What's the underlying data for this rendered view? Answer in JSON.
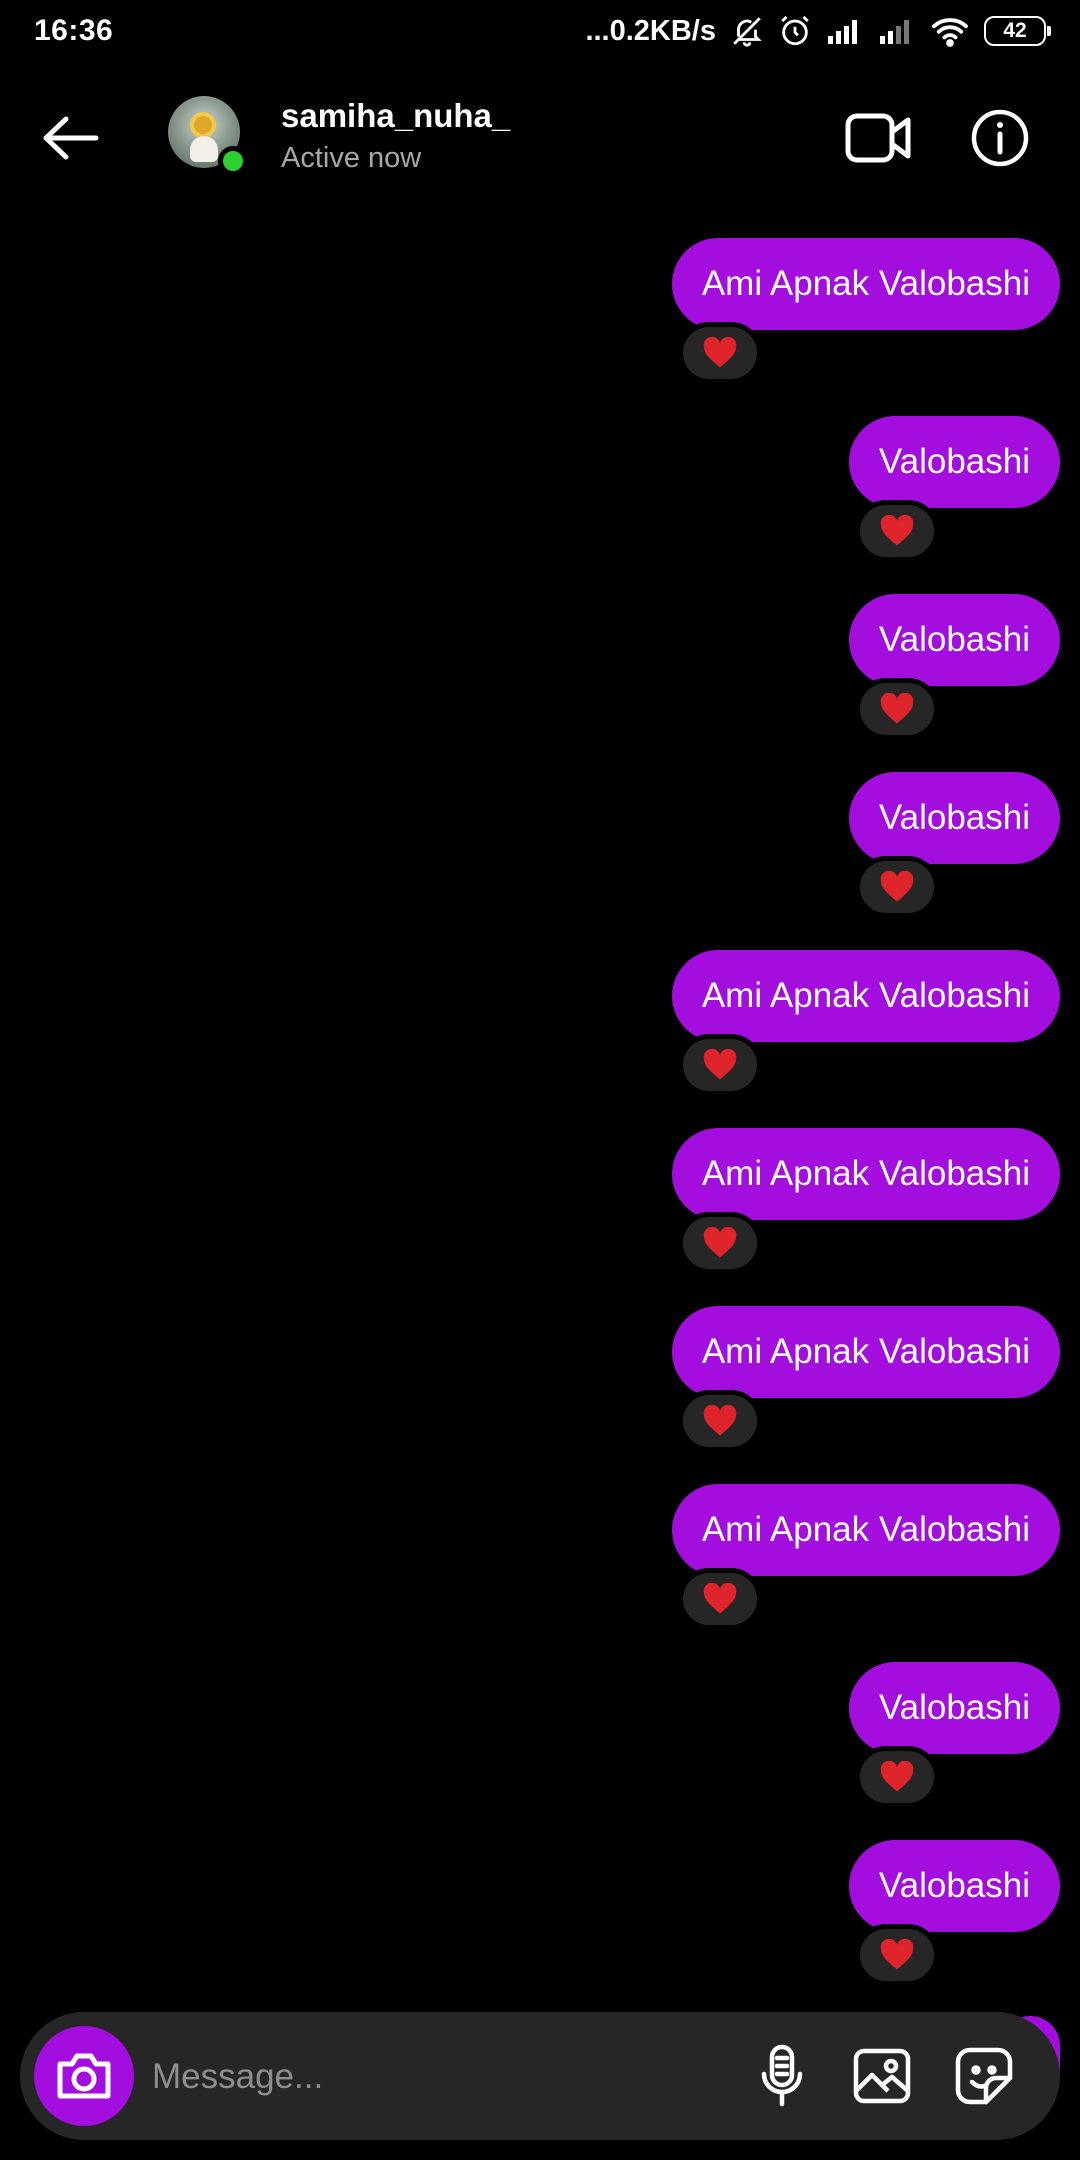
{
  "status_bar": {
    "time": "16:36",
    "network_speed": "...0.2KB/s",
    "battery": "42",
    "icons": [
      "mute-icon",
      "alarm-icon",
      "signal-icon",
      "signal-icon",
      "wifi-icon"
    ]
  },
  "header": {
    "username": "samiha_nuha_",
    "status": "Active now"
  },
  "messages": [
    {
      "text": "Ami Apnak Valobashi",
      "reaction": "❤️"
    },
    {
      "text": "Valobashi",
      "reaction": "❤️"
    },
    {
      "text": "Valobashi",
      "reaction": "❤️"
    },
    {
      "text": "Valobashi",
      "reaction": "❤️"
    },
    {
      "text": "Ami Apnak Valobashi",
      "reaction": "❤️"
    },
    {
      "text": "Ami Apnak Valobashi",
      "reaction": "❤️"
    },
    {
      "text": "Ami Apnak Valobashi",
      "reaction": "❤️"
    },
    {
      "text": "Ami Apnak Valobashi",
      "reaction": "❤️"
    },
    {
      "text": "Valobashi",
      "reaction": "❤️"
    },
    {
      "text": "Valobashi",
      "reaction": "❤️"
    }
  ],
  "composer": {
    "placeholder": "Message..."
  },
  "colors": {
    "bubble": "#a30ede",
    "background": "#000000",
    "online": "#2dd12d",
    "reaction_bg": "#262626"
  }
}
